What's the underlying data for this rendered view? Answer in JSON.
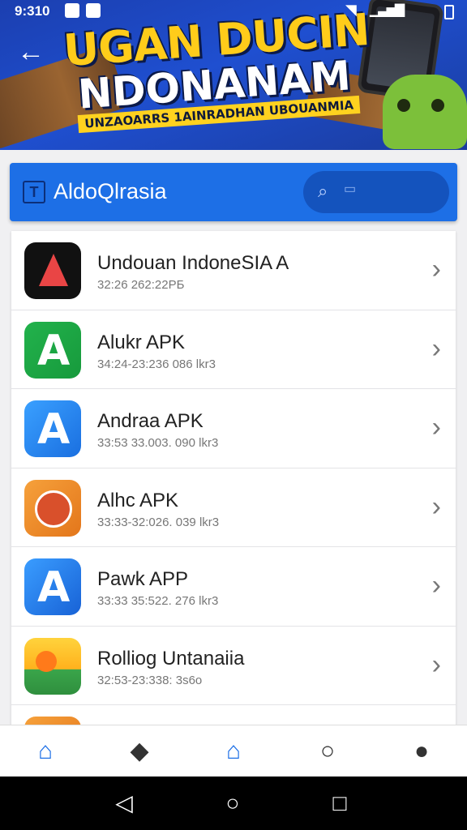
{
  "status_bar": {
    "time": "9:310"
  },
  "banner": {
    "title_line1": "UGAN DUCIN",
    "title_line2": "NDONANAM",
    "subtitle": "UNZAOARRS 1AINRADHAN UBOUANMIA"
  },
  "appbar": {
    "logo_glyph": "T",
    "title": "AldoQlrasia",
    "search_placeholder": "▭"
  },
  "items": [
    {
      "name": "Undouan IndoneSIA A",
      "meta": "32:26 262:22PБ",
      "icon": "black-warning-icon"
    },
    {
      "name": "Alukr APK",
      "meta": "34:24-23:236 086 lkr3",
      "icon": "green-a-icon"
    },
    {
      "name": "Andraa APK",
      "meta": "33:53 33.003. 090 lkr3",
      "icon": "blue-a-icon"
    },
    {
      "name": "Alhc APK",
      "meta": "33:33-32:026. 039 lkr3",
      "icon": "orange-seal-icon"
    },
    {
      "name": "Pawk APP",
      "meta": "33:33 35:522. 276 lkr3",
      "icon": "blue-a2-icon"
    },
    {
      "name": "Rolliog Untanaiia",
      "meta": "32:53-23:338: 3s6o",
      "icon": "sun-landscape-icon"
    }
  ],
  "bottom_nav": [
    "home",
    "play",
    "shop",
    "discover",
    "profile"
  ],
  "colors": {
    "primary": "#1d6fe6",
    "banner": "#1f4fd0",
    "accent_yellow": "#ffcc1a"
  }
}
